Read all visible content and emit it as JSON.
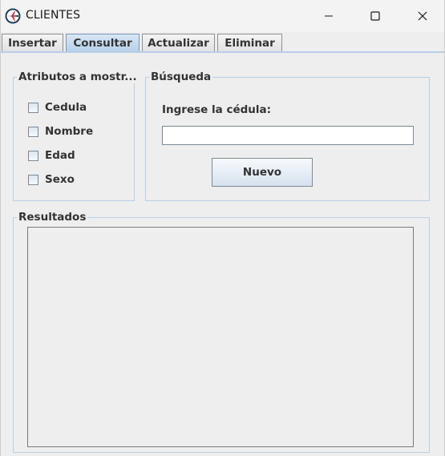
{
  "window": {
    "title": "CLIENTES",
    "controls": {
      "minimize": "minimize-icon",
      "maximize": "maximize-icon",
      "close": "close-icon"
    }
  },
  "tabs": [
    {
      "label": "Insertar",
      "selected": false
    },
    {
      "label": "Consultar",
      "selected": true
    },
    {
      "label": "Actualizar",
      "selected": false
    },
    {
      "label": "Eliminar",
      "selected": false
    }
  ],
  "attributes_panel": {
    "title": "Atributos a mostr...",
    "checkboxes": [
      {
        "label": "Cedula",
        "checked": false
      },
      {
        "label": "Nombre",
        "checked": false
      },
      {
        "label": "Edad",
        "checked": false
      },
      {
        "label": "Sexo",
        "checked": false
      }
    ]
  },
  "search_panel": {
    "title": "Búsqueda",
    "prompt": "Ingrese la cédula:",
    "input_value": "",
    "button_label": "Nuevo"
  },
  "results_panel": {
    "title": "Resultados"
  },
  "colors": {
    "window_bg": "#eeeeee",
    "panel_border": "#b8cfe5",
    "selected_tab": "#c7dcf1",
    "app_icon_bg": "#1f3a5c",
    "app_icon_accent": "#d62b2b"
  }
}
